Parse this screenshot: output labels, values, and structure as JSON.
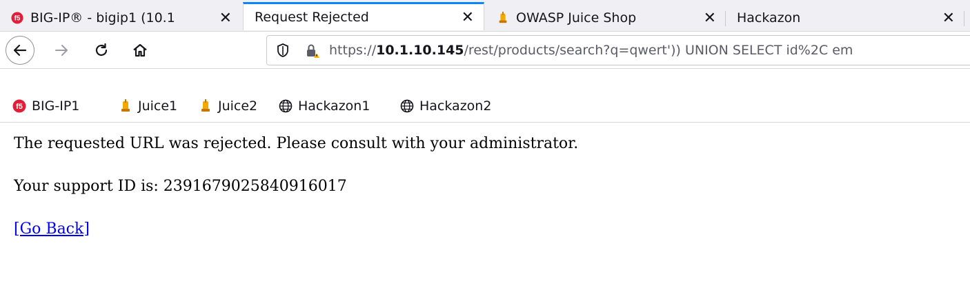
{
  "tabs": [
    {
      "label": "BIG-IP® - bigip1 (10.1",
      "icon": "f5-icon",
      "active": false
    },
    {
      "label": "Request Rejected",
      "icon": "",
      "active": true
    },
    {
      "label": "OWASP Juice Shop",
      "icon": "juice-icon",
      "active": false
    },
    {
      "label": "Hackazon",
      "icon": "",
      "active": false
    }
  ],
  "nav": {
    "url_prefix": "https://",
    "url_host": "10.1.10.145",
    "url_path": "/rest/products/search?q=qwert')) UNION SELECT id%2C em"
  },
  "bookmarks": [
    {
      "label": "BIG-IP1",
      "icon": "f5-icon"
    },
    {
      "label": "Juice1",
      "icon": "juice-icon"
    },
    {
      "label": "Juice2",
      "icon": "juice-icon"
    },
    {
      "label": "Hackazon1",
      "icon": "globe-icon"
    },
    {
      "label": "Hackazon2",
      "icon": "globe-icon"
    }
  ],
  "page": {
    "message": "The requested URL was rejected. Please consult with your administrator.",
    "support_id_line": "Your support ID is: 2391679025840916017",
    "go_back": "[Go Back]"
  },
  "colors": {
    "accent": "#0a84ff",
    "link": "#0000ee",
    "f5": "#e21d38"
  }
}
